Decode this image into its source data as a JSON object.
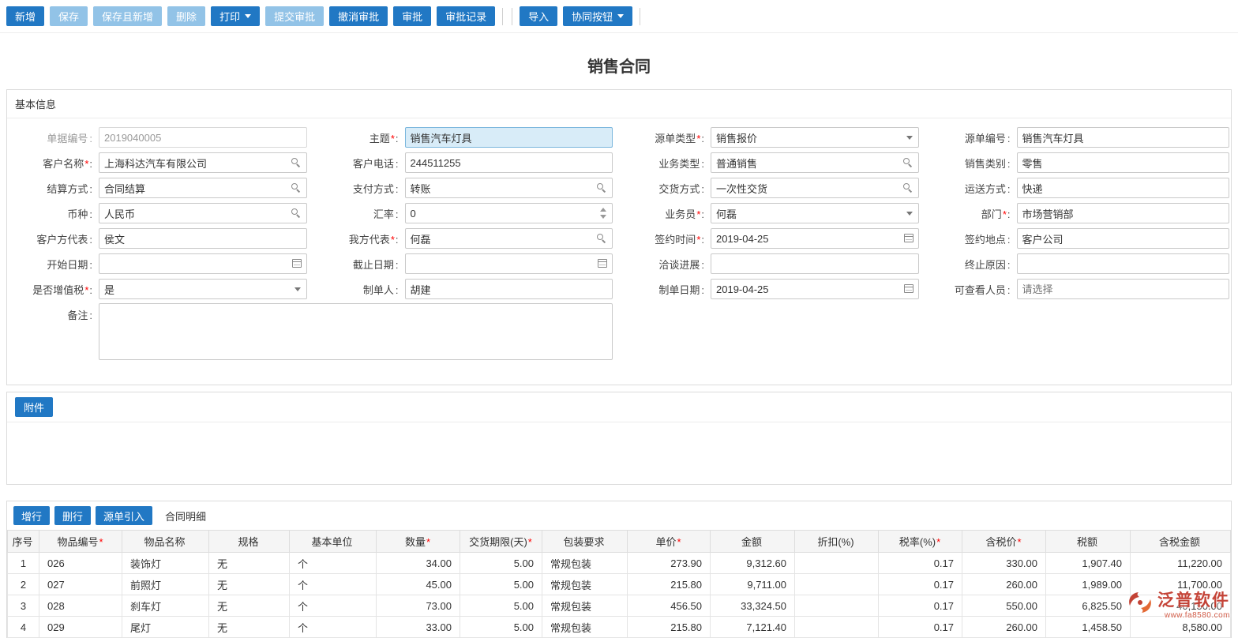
{
  "ui": {
    "colon": ":"
  },
  "toolbar": {
    "buttons": [
      {
        "label": "新增"
      },
      {
        "label": "保存"
      },
      {
        "label": "保存且新增"
      },
      {
        "label": "删除"
      },
      {
        "label": "打印"
      },
      {
        "label": "提交审批"
      },
      {
        "label": "撤消审批"
      },
      {
        "label": "审批"
      },
      {
        "label": "审批记录"
      },
      {
        "label": "导入"
      },
      {
        "label": "协同按钮"
      }
    ]
  },
  "page_title": "销售合同",
  "basic_info": {
    "section_title": "基本信息",
    "fields": {
      "doc_no": {
        "label": "单据编号",
        "req": "",
        "value": "2019040005"
      },
      "subject": {
        "label": "主题",
        "req": "*",
        "value": "销售汽车灯具"
      },
      "source_type": {
        "label": "源单类型",
        "req": "*",
        "value": "销售报价"
      },
      "source_no": {
        "label": "源单编号",
        "req": "",
        "value": "销售汽车灯具"
      },
      "customer_name": {
        "label": "客户名称",
        "req": "*",
        "value": "上海科达汽车有限公司"
      },
      "customer_phone": {
        "label": "客户电话",
        "req": "",
        "value": "244511255"
      },
      "business_type": {
        "label": "业务类型",
        "req": "",
        "value": "普通销售"
      },
      "sales_category": {
        "label": "销售类别",
        "req": "",
        "value": "零售"
      },
      "settlement_method": {
        "label": "结算方式",
        "req": "",
        "value": "合同结算"
      },
      "payment_method": {
        "label": "支付方式",
        "req": "",
        "value": "转账"
      },
      "delivery_method": {
        "label": "交货方式",
        "req": "",
        "value": "一次性交货"
      },
      "shipping_method": {
        "label": "运送方式",
        "req": "",
        "value": "快递"
      },
      "currency": {
        "label": "币种",
        "req": "",
        "value": "人民币"
      },
      "exchange_rate": {
        "label": "汇率",
        "req": "",
        "value": "0"
      },
      "salesman": {
        "label": "业务员",
        "req": "*",
        "value": "何磊"
      },
      "department": {
        "label": "部门",
        "req": "*",
        "value": "市场营销部"
      },
      "customer_rep": {
        "label": "客户方代表",
        "req": "",
        "value": "侯文"
      },
      "our_rep": {
        "label": "我方代表",
        "req": "*",
        "value": "何磊"
      },
      "sign_time": {
        "label": "签约时间",
        "req": "*",
        "value": "2019-04-25"
      },
      "sign_place": {
        "label": "签约地点",
        "req": "",
        "value": "客户公司"
      },
      "start_date": {
        "label": "开始日期",
        "req": "",
        "value": ""
      },
      "end_date": {
        "label": "截止日期",
        "req": "",
        "value": ""
      },
      "negotiation_progress": {
        "label": "洽谈进展",
        "req": "",
        "value": ""
      },
      "termination_reason": {
        "label": "终止原因",
        "req": "",
        "value": ""
      },
      "is_vat": {
        "label": "是否增值税",
        "req": "*",
        "value": "是"
      },
      "preparer": {
        "label": "制单人",
        "req": "",
        "value": "胡建"
      },
      "prepare_date": {
        "label": "制单日期",
        "req": "",
        "value": "2019-04-25"
      },
      "viewers": {
        "label": "可查看人员",
        "req": "",
        "value": "",
        "placeholder": "请选择"
      },
      "remark": {
        "label": "备注",
        "req": "",
        "value": ""
      }
    }
  },
  "attachments": {
    "button_label": "附件"
  },
  "detail": {
    "toolbar": {
      "add_row": "增行",
      "delete_row": "删行",
      "source_import": "源单引入",
      "section_title": "合同明细"
    },
    "columns": [
      {
        "label": "序号",
        "req": ""
      },
      {
        "label": "物品编号",
        "req": "*"
      },
      {
        "label": "物品名称",
        "req": ""
      },
      {
        "label": "规格",
        "req": ""
      },
      {
        "label": "基本单位",
        "req": ""
      },
      {
        "label": "数量",
        "req": "*"
      },
      {
        "label": "交货期限(天)",
        "req": "*"
      },
      {
        "label": "包装要求",
        "req": ""
      },
      {
        "label": "单价",
        "req": "*"
      },
      {
        "label": "金额",
        "req": ""
      },
      {
        "label": "折扣(%)",
        "req": ""
      },
      {
        "label": "税率(%)",
        "req": "*"
      },
      {
        "label": "含税价",
        "req": "*"
      },
      {
        "label": "税额",
        "req": ""
      },
      {
        "label": "含税金额",
        "req": ""
      }
    ],
    "rows": [
      [
        "1",
        "026",
        "装饰灯",
        "无",
        "个",
        "34.00",
        "5.00",
        "常规包装",
        "273.90",
        "9,312.60",
        "",
        "0.17",
        "330.00",
        "1,907.40",
        "11,220.00"
      ],
      [
        "2",
        "027",
        "前照灯",
        "无",
        "个",
        "45.00",
        "5.00",
        "常规包装",
        "215.80",
        "9,711.00",
        "",
        "0.17",
        "260.00",
        "1,989.00",
        "11,700.00"
      ],
      [
        "3",
        "028",
        "刹车灯",
        "无",
        "个",
        "73.00",
        "5.00",
        "常规包装",
        "456.50",
        "33,324.50",
        "",
        "0.17",
        "550.00",
        "6,825.50",
        "40,150.00"
      ],
      [
        "4",
        "029",
        "尾灯",
        "无",
        "个",
        "33.00",
        "5.00",
        "常规包装",
        "215.80",
        "7,121.40",
        "",
        "0.17",
        "260.00",
        "1,458.50",
        "8,580.00"
      ]
    ]
  },
  "watermark": {
    "brand": "泛普软件",
    "url": "www.fa8580.com"
  }
}
